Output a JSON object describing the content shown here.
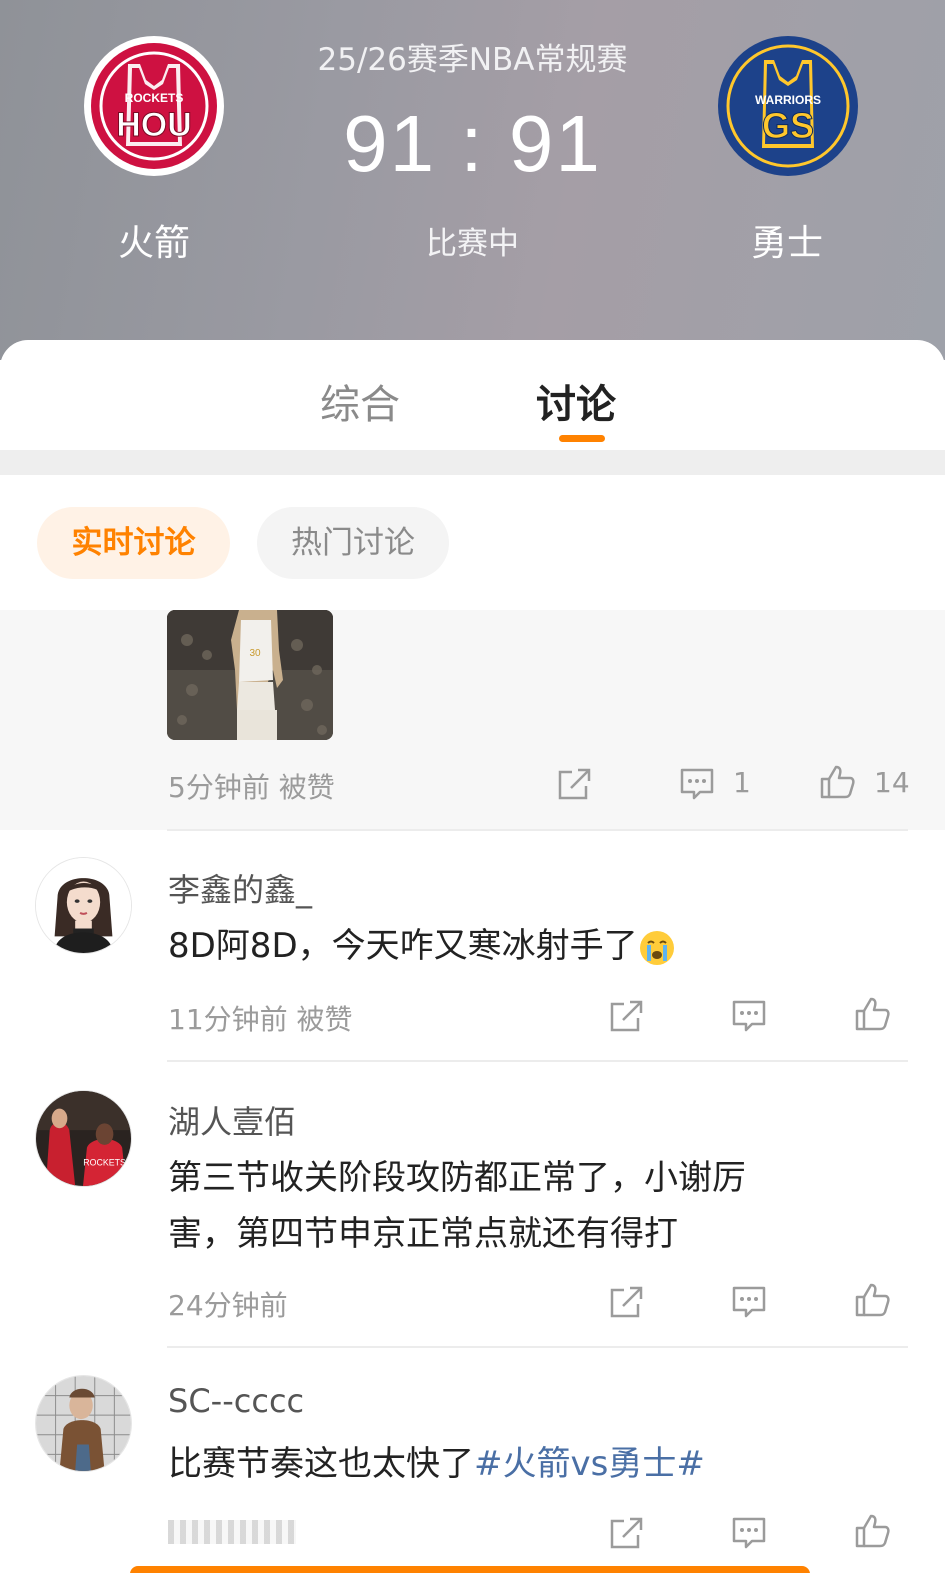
{
  "header": {
    "season": "25/26赛季NBA常规赛",
    "score": "91 : 91",
    "status": "比赛中",
    "home": {
      "name": "火箭",
      "logo_top": "ROCKETS",
      "logo_main": "HOU",
      "color": "#ce1141"
    },
    "away": {
      "name": "勇士",
      "logo_top": "WARRIORS",
      "logo_main": "GS",
      "color": "#1d428a",
      "accent": "#ffc72c"
    }
  },
  "tabs": [
    {
      "label": "综合",
      "active": false
    },
    {
      "label": "讨论",
      "active": true
    }
  ],
  "filters": [
    {
      "label": "实时讨论",
      "active": true
    },
    {
      "label": "热门讨论",
      "active": false
    }
  ],
  "accent_color": "#ff8200",
  "top_post": {
    "meta": "5分钟前 被赞",
    "comments": "1",
    "likes": "14"
  },
  "comments": [
    {
      "user": "李鑫的鑫_",
      "text": "8D阿8D，今天咋又寒冰射手了",
      "emoji": "crying-face-icon",
      "meta": "11分钟前 被赞"
    },
    {
      "user": "湖人壹佰",
      "text_line1": "第三节收关阶段攻防都正常了，小谢厉",
      "text_line2": "害，第四节申京正常点就还有得打",
      "meta": "24分钟前"
    },
    {
      "user": "SC--cccc",
      "text": "比赛节奏这也太快了",
      "topic": "#火箭vs勇士#"
    }
  ],
  "icons": [
    "share-icon",
    "comment-icon",
    "like-icon"
  ]
}
